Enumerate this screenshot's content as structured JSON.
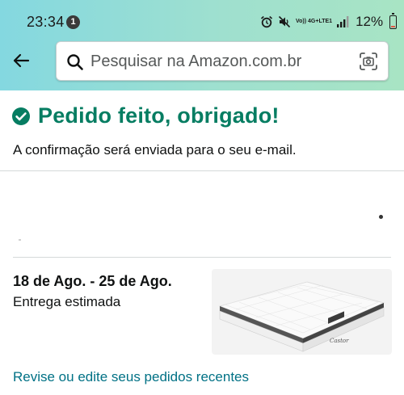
{
  "status_bar": {
    "time": "23:34",
    "notification_count": "1",
    "network_top": "Vo)) 4G+",
    "network_bottom": "LTE1",
    "battery_percent": "12%",
    "battery_level": 0.12
  },
  "search": {
    "placeholder": "Pesquisar na Amazon.com.br"
  },
  "confirmation": {
    "title": "Pedido feito, obrigado!",
    "subtitle": "A confirmação será enviada para o seu e-mail."
  },
  "delivery": {
    "dates": "18 de Ago. - 25 de Ago.",
    "label": "Entrega estimada",
    "product_brand_text": "Castor"
  },
  "links": {
    "review_orders": "Revise ou edite seus pedidos recentes"
  },
  "colors": {
    "header_gradient_start": "#84d8e0",
    "header_gradient_end": "#a8e4c4",
    "success_green": "#067d62",
    "link_teal": "#007185"
  }
}
